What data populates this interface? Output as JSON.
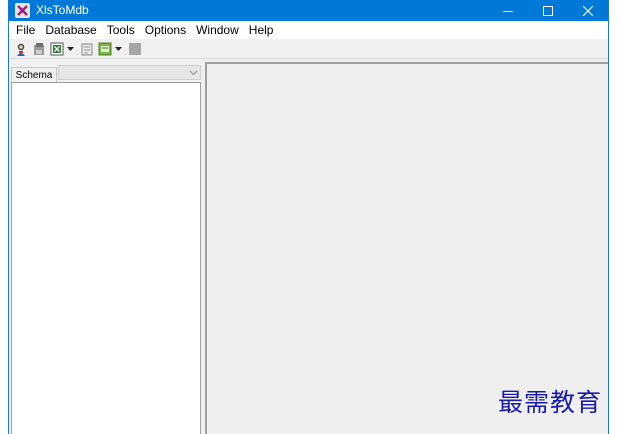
{
  "window": {
    "title": "XlsToMdb"
  },
  "menu": [
    "File",
    "Database",
    "Tools",
    "Options",
    "Window",
    "Help"
  ],
  "toolbar": {
    "buttons": [
      "wizard-icon",
      "save-icon",
      "excel-icon",
      "report-icon",
      "script-icon",
      "stop-icon"
    ]
  },
  "left_pane": {
    "tab_label": "Schema",
    "combo_value": ""
  },
  "watermark": "最需教育",
  "colors": {
    "titlebar": "#0078d7",
    "watermark": "#1a1aa8",
    "mdi_background": "#efefef"
  }
}
